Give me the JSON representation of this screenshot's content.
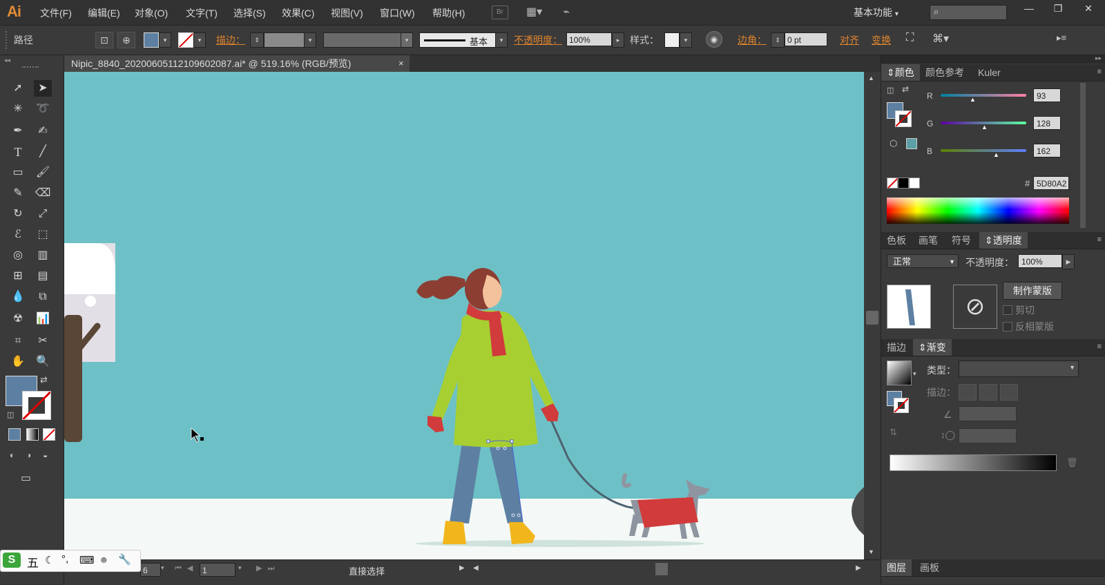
{
  "app": {
    "logo": "Ai"
  },
  "menu": [
    "文件(F)",
    "编辑(E)",
    "对象(O)",
    "文字(T)",
    "选择(S)",
    "效果(C)",
    "视图(V)",
    "窗口(W)",
    "帮助(H)"
  ],
  "menu_icons": {
    "bridge": "Br"
  },
  "workspace": {
    "label": "基本功能",
    "chevron": "▾"
  },
  "window_buttons": [
    "—",
    "❐",
    "✕"
  ],
  "control": {
    "selection_type": "路径",
    "stroke_label": "描边：",
    "stroke_style": "基本",
    "opacity_label": "不透明度：",
    "opacity_value": "100%",
    "style_label": "样式：",
    "corner_label": "边角：",
    "corner_value": "0 pt",
    "align_label": "对齐",
    "transform_label": "变换",
    "fill_color": "#5d80a2"
  },
  "document": {
    "tab_title": "Nipic_8840_20200605112109602087.ai* @ 519.16% (RGB/预览)",
    "close": "×"
  },
  "status": {
    "zoom_partial": "6",
    "artboard": "1",
    "tool_name": "直接选择"
  },
  "panels": {
    "color": {
      "tabs": [
        "颜色",
        "颜色参考",
        "Kuler"
      ],
      "r_label": "R",
      "r_value": "93",
      "g_label": "G",
      "g_value": "128",
      "b_label": "B",
      "b_value": "162",
      "hex_label": "#",
      "hex_value": "5D80A2"
    },
    "transparency": {
      "tabs": [
        "色板",
        "画笔",
        "符号",
        "透明度"
      ],
      "blend_mode": "正常",
      "opacity_label": "不透明度：",
      "opacity_value": "100%",
      "make_mask": "制作蒙版",
      "clip": "剪切",
      "invert_mask": "反相蒙版"
    },
    "gradient": {
      "tabs": [
        "描边",
        "渐变"
      ],
      "type_label": "类型：",
      "stroke_label": "描边："
    },
    "layers": {
      "tabs": [
        "图层",
        "画板"
      ]
    }
  },
  "ime": {
    "label": "五"
  },
  "colors": {
    "canvas_bg": "#6dc1c6",
    "snow": "#f4f9f7",
    "coat": "#a7cf31",
    "scarf": "#d13b3b",
    "hair": "#8c3e33",
    "jeans": "#5d80a2",
    "boots": "#f2b61d",
    "dog_coat": "#d13b3b",
    "dog": "#8f95a0",
    "tree_trunk": "#5a4636"
  }
}
